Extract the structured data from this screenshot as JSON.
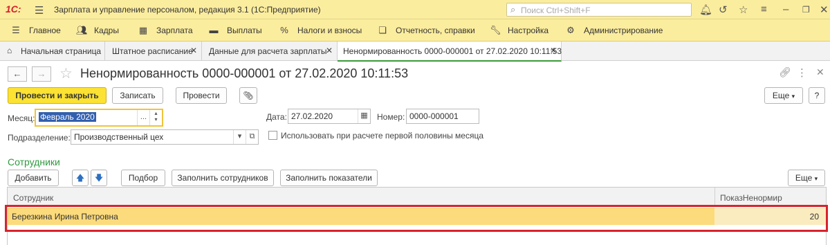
{
  "app": {
    "logo": "1С:",
    "title": "Зарплата и управление персоналом, редакция 3.1  (1С:Предприятие)",
    "search_placeholder": "Поиск Ctrl+Shift+F"
  },
  "sections": [
    {
      "label": "Главное",
      "icon": "menu-icon"
    },
    {
      "label": "Кадры",
      "icon": "people-icon"
    },
    {
      "label": "Зарплата",
      "icon": "calculator-icon"
    },
    {
      "label": "Выплаты",
      "icon": "wallet-icon"
    },
    {
      "label": "Налоги и взносы",
      "icon": "percent-icon"
    },
    {
      "label": "Отчетность, справки",
      "icon": "documents-icon"
    },
    {
      "label": "Настройка",
      "icon": "wrench-icon"
    },
    {
      "label": "Администрирование",
      "icon": "gear-icon"
    }
  ],
  "tabs": [
    {
      "label": "Начальная страница"
    },
    {
      "label": "Штатное расписание"
    },
    {
      "label": "Данные для расчета зарплаты"
    },
    {
      "label": "Ненормированность 0000-000001 от 27.02.2020 10:11:53"
    }
  ],
  "form": {
    "title": "Ненормированность 0000-000001 от 27.02.2020 10:11:53",
    "buttons": {
      "post_close": "Провести и закрыть",
      "save": "Записать",
      "post": "Провести",
      "more": "Еще"
    },
    "month_label": "Месяц:",
    "month_value": "Февраль 2020",
    "date_label": "Дата:",
    "date_value": "27.02.2020",
    "number_label": "Номер:",
    "number_value": "0000-000001",
    "dept_label": "Подразделение:",
    "dept_value": "Производственный цех",
    "checkbox_label": "Использовать при расчете первой половины месяца",
    "checkbox_checked": false
  },
  "employees": {
    "section_title": "Сотрудники",
    "buttons": {
      "add": "Добавить",
      "pick": "Подбор",
      "fill_employees": "Заполнить сотрудников",
      "fill_indicators": "Заполнить показатели",
      "more": "Еще"
    },
    "columns": [
      "Сотрудник",
      "ПоказНенормир"
    ],
    "rows": [
      {
        "employee": "Березкина Ирина Петровна",
        "value": "20"
      }
    ]
  },
  "colors": {
    "title_bar": "#fbed9e",
    "primary_button": "#fbe233",
    "section_title": "#2e9a3e",
    "selected_row": "#fcdb7c",
    "highlight_frame": "#d9222b",
    "active_tab_underline": "#3a9a3a"
  }
}
